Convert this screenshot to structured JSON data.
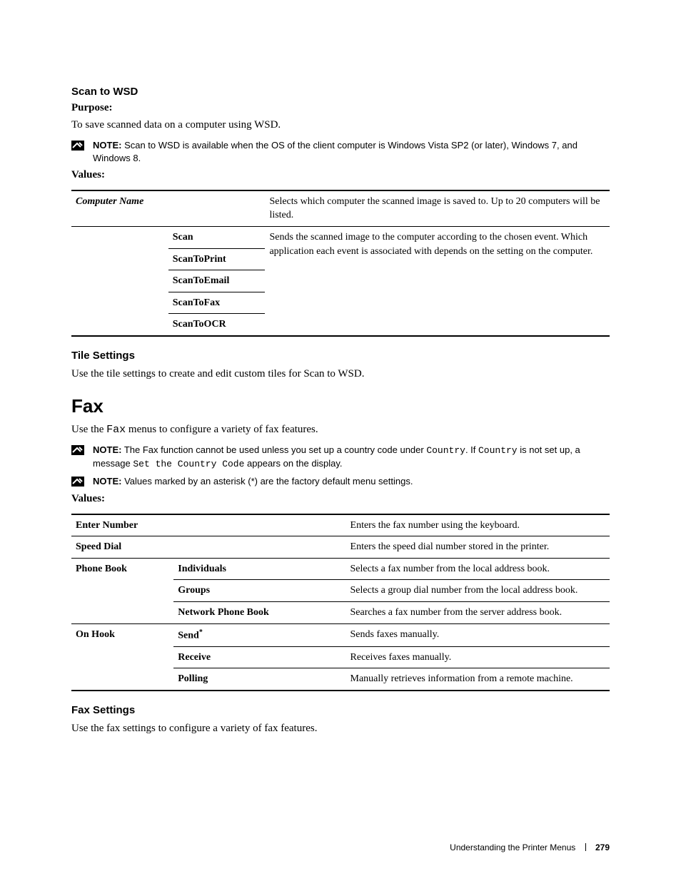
{
  "section1": {
    "heading": "Scan to WSD",
    "purpose_label": "Purpose:",
    "purpose_text": "To save scanned data on a computer using WSD.",
    "note_label": "NOTE:",
    "note_text": " Scan to WSD is available when the OS of the client computer is Windows Vista SP2 (or later), Windows 7, and Windows 8.",
    "values_label": "Values:",
    "table": {
      "col1_header": "Computer Name",
      "col1_desc": "Selects which computer the scanned image is saved to. Up to 20 computers will be listed.",
      "rows_label": [
        "Scan",
        "ScanToPrint",
        "ScanToEmail",
        "ScanToFax",
        "ScanToOCR"
      ],
      "rows_desc": "Sends the scanned image to the computer according to the chosen event. Which application each event is associated with depends on the setting on the computer."
    }
  },
  "section2": {
    "heading": "Tile Settings",
    "text": "Use the tile settings to create and edit custom tiles for Scan to WSD."
  },
  "fax": {
    "heading": "Fax",
    "intro_pre": "Use the ",
    "intro_mono": "Fax",
    "intro_post": " menus to configure a variety of fax features.",
    "note1_label": "NOTE:",
    "note1_a": " The Fax function cannot be used unless you set up a country code under ",
    "note1_b": "Country",
    "note1_c": ". If ",
    "note1_d": "Country",
    "note1_e": " is not set up, a message ",
    "note1_f": "Set the Country Code",
    "note1_g": " appears on the display.",
    "note2_label": "NOTE:",
    "note2_text": " Values marked by an asterisk (*) are the factory default menu settings.",
    "values_label": "Values:",
    "table": {
      "r1_c1": "Enter Number",
      "r1_desc": "Enters the fax number using the keyboard.",
      "r2_c1": "Speed Dial",
      "r2_desc": "Enters the speed dial number stored in the printer.",
      "r3_c1": "Phone Book",
      "r3a_c2": "Individuals",
      "r3a_desc": "Selects a fax number from the local address book.",
      "r3b_c2": "Groups",
      "r3b_desc": "Selects a group dial number from the local address book.",
      "r3c_c2": "Network Phone Book",
      "r3c_desc": "Searches a fax number from the server address book.",
      "r4_c1": "On Hook",
      "r4a_c2": "Send",
      "r4a_sup": "*",
      "r4a_desc": "Sends faxes manually.",
      "r4b_c2": "Receive",
      "r4b_desc": "Receives faxes manually.",
      "r4c_c2": "Polling",
      "r4c_desc": "Manually retrieves information from a remote machine."
    }
  },
  "section3": {
    "heading": "Fax Settings",
    "text": "Use the fax settings to configure a variety of fax features."
  },
  "footer": {
    "title": "Understanding the Printer Menus",
    "page": "279"
  }
}
